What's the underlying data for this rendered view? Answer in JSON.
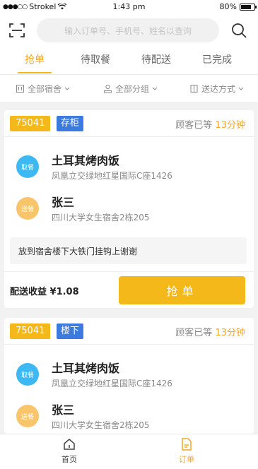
{
  "status_bar": {
    "carrier": "Strokel",
    "time": "1:43 pm",
    "battery": "80%"
  },
  "search": {
    "placeholder": "输入订单号、手机号、姓名以查询"
  },
  "tabs": [
    {
      "label": "抢单",
      "active": true
    },
    {
      "label": "待取餐",
      "active": false
    },
    {
      "label": "待配送",
      "active": false
    },
    {
      "label": "已完成",
      "active": false
    }
  ],
  "filters": [
    {
      "label": "全部宿舍",
      "icon": "building-icon"
    },
    {
      "label": "全部分组",
      "icon": "person-icon"
    },
    {
      "label": "送达方式",
      "icon": "door-icon"
    }
  ],
  "orders": [
    {
      "order_no": "75041",
      "tag": "存柜",
      "wait_prefix": "顾客已等",
      "wait_minutes": "13分钟",
      "pickup": {
        "badge": "取餐",
        "name": "土耳其烤肉饭",
        "address": "凤凰立交绿地红星国际C座1426"
      },
      "delivery": {
        "badge": "送餐",
        "name": "张三",
        "address": "四川大学女生宿舍2栋205"
      },
      "note": "放到宿舍楼下大铁门挂钩上谢谢",
      "income": "配送收益  ¥1.08",
      "action": "抢单"
    },
    {
      "order_no": "75041",
      "tag": "楼下",
      "wait_prefix": "顾客已等",
      "wait_minutes": "13分钟",
      "pickup": {
        "badge": "取餐",
        "name": "土耳其烤肉饭",
        "address": "凤凰立交绿地红星国际C座1426"
      },
      "delivery": {
        "badge": "送餐",
        "name": "张三",
        "address": "四川大学女生宿舍2栋205"
      }
    }
  ],
  "bottom_nav": [
    {
      "label": "首页",
      "icon": "home-icon",
      "active": false
    },
    {
      "label": "订单",
      "icon": "order-icon",
      "active": true
    }
  ],
  "colors": {
    "accent": "#f5b81b",
    "active_text": "#f5a623",
    "tag_blue": "#3b7be0",
    "pickup_badge": "#3cb8f3",
    "delivery_badge": "#f9c56a"
  }
}
